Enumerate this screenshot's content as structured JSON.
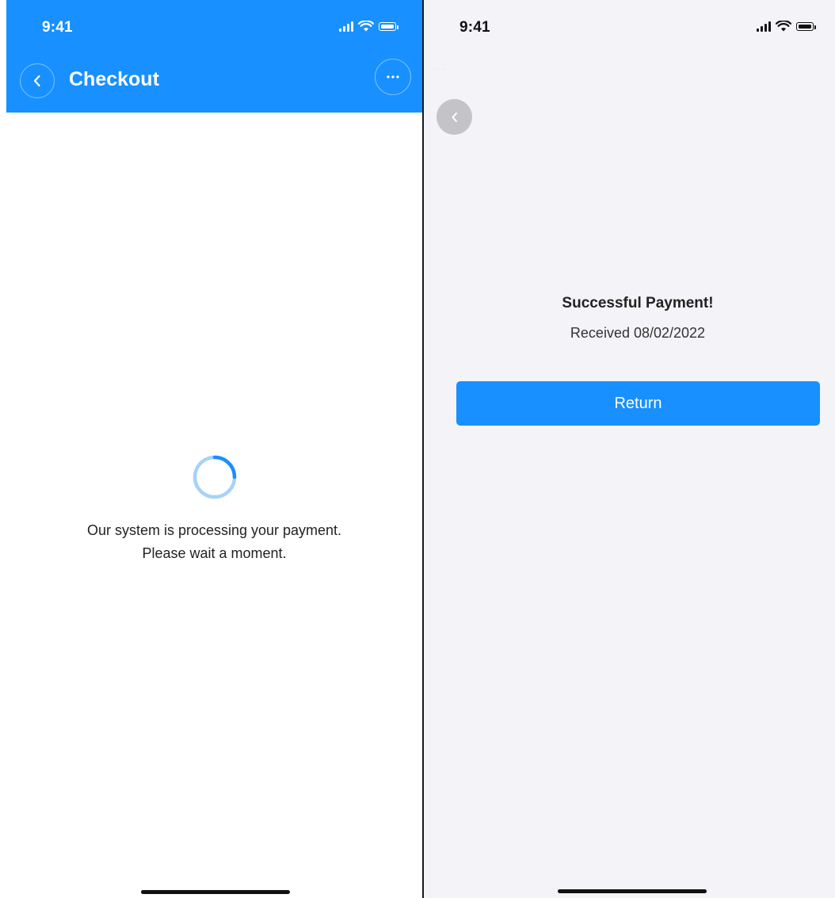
{
  "left_screen": {
    "status_bar": {
      "time": "9:41"
    },
    "nav": {
      "title": "Checkout",
      "back_icon": "chevron-left-icon",
      "more_icon": "ellipsis-icon"
    },
    "loading": {
      "spinner_icon": "spinner-icon",
      "message_line1": "Our system is processing your payment.",
      "message_line2": "Please wait a moment."
    }
  },
  "right_screen": {
    "status_bar": {
      "time": "9:41"
    },
    "nav": {
      "back_icon": "chevron-left-icon"
    },
    "result": {
      "title": "Successful Payment!",
      "date": "Received 08/02/2022",
      "button_label": "Return"
    }
  },
  "colors": {
    "primary": "#1890ff",
    "right_background": "#f4f4f8",
    "back_button_gray": "#c4c4c8"
  }
}
